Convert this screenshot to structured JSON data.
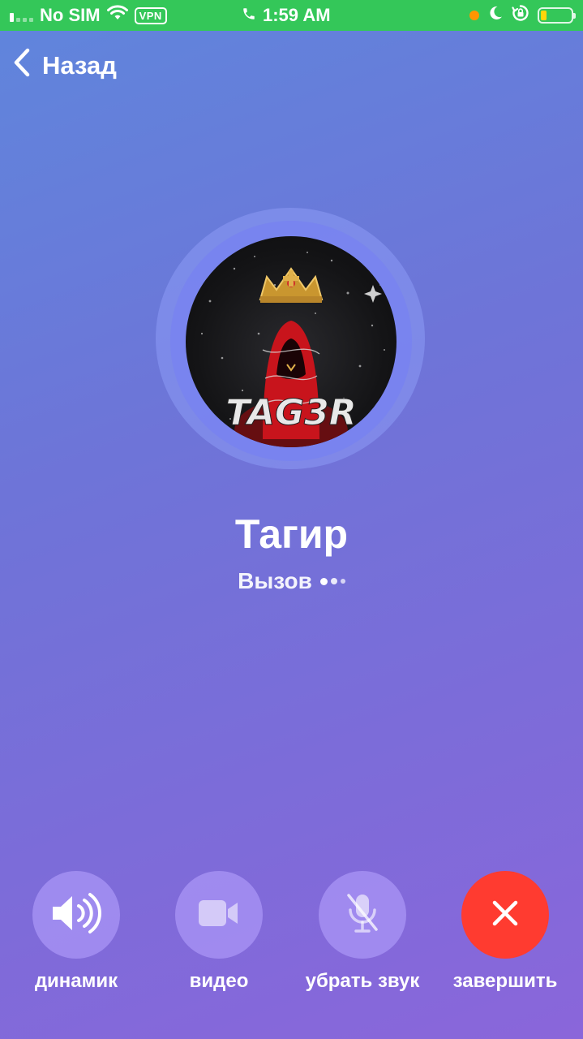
{
  "status_bar": {
    "carrier": "No SIM",
    "vpn": "VPN",
    "time": "1:59 AM",
    "battery_level": 0.2,
    "battery_color": "#ffd60a",
    "background": "#34c759"
  },
  "nav": {
    "back_label": "Назад"
  },
  "contact": {
    "name": "Тагир",
    "avatar_text": "TAG3R"
  },
  "call": {
    "status": "Вызов"
  },
  "controls": {
    "speaker": {
      "label": "динамик",
      "icon": "speaker-icon"
    },
    "video": {
      "label": "видео",
      "icon": "video-camera-icon"
    },
    "mute": {
      "label": "убрать звук",
      "icon": "microphone-off-icon"
    },
    "end": {
      "label": "завершить",
      "icon": "close-icon",
      "color": "#ff3b30"
    }
  }
}
